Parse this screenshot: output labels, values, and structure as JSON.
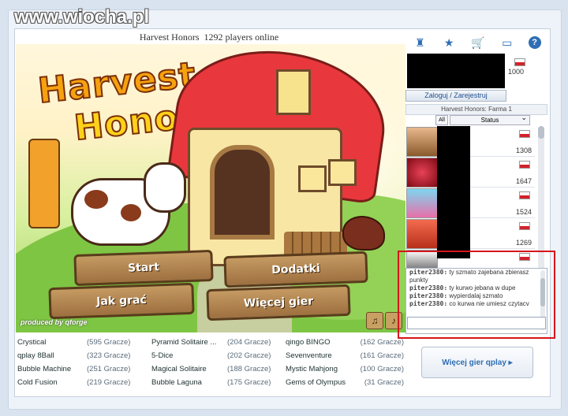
{
  "watermark": "www.wiocha.pl",
  "header": {
    "title": "Harvest Honors",
    "players_online": "1292 players online"
  },
  "game": {
    "logo_line1": "Harvest",
    "logo_line2": "Honors",
    "buttons": {
      "start": "Start",
      "addons": "Dodatki",
      "how_to_play": "Jak grać",
      "more_games": "Więcej gier"
    },
    "produced_by": "produced by qforge",
    "sound_icons": [
      "music-off-icon",
      "sound-off-icon"
    ]
  },
  "games_list": [
    [
      {
        "name": "Crystical",
        "count": "(595 Gracze)"
      },
      {
        "name": "Pyramid Solitaire ...",
        "count": "(204 Gracze)"
      },
      {
        "name": "qingo BINGO",
        "count": "(162 Gracze)"
      }
    ],
    [
      {
        "name": "qplay 8Ball",
        "count": "(323 Gracze)"
      },
      {
        "name": "5-Dice",
        "count": "(202 Gracze)"
      },
      {
        "name": "Sevenventure",
        "count": "(161 Gracze)"
      }
    ],
    [
      {
        "name": "Bubble Machine",
        "count": "(251 Gracze)"
      },
      {
        "name": "Magical Solitaire",
        "count": "(188 Gracze)"
      },
      {
        "name": "Mystic Mahjong",
        "count": "(100 Gracze)"
      }
    ],
    [
      {
        "name": "Cold Fusion",
        "count": "(219 Gracze)"
      },
      {
        "name": "Bubble Laguna",
        "count": "(175 Gracze)"
      },
      {
        "name": "Gems of Olympus",
        "count": "(31 Gracze)"
      }
    ]
  ],
  "sidebar": {
    "toolbar_icons": [
      "lobby-icon",
      "ranking-icon",
      "shop-icon",
      "payment-icon",
      "help-icon"
    ],
    "help_label": "?",
    "user_score": "1000",
    "login_label": "Zaloguj / Zarejestruj",
    "room_title": "Harvest Honors: Farma 1",
    "filter_all": "All",
    "filter_status": "Status",
    "players": [
      {
        "score": "1308"
      },
      {
        "score": "1647"
      },
      {
        "score": "1524"
      },
      {
        "score": "1269"
      },
      {
        "score": ""
      }
    ],
    "chat": [
      {
        "nick": "piter2380:",
        "text": "ty szmato zajebana zbierasz punkty"
      },
      {
        "nick": "piter2380:",
        "text": "ty kurwo jebana w dupe"
      },
      {
        "nick": "piter2380:",
        "text": "wypierdalaj szmato"
      },
      {
        "nick": "piter2380:",
        "text": "co kurwa nie umiesz czytacv"
      }
    ],
    "more_games_label": "Więcej gier qplay ▸"
  },
  "colors": {
    "accent": "#2e6eb4",
    "highlight": "#d6151c",
    "online_bar": "#5fbd44"
  }
}
